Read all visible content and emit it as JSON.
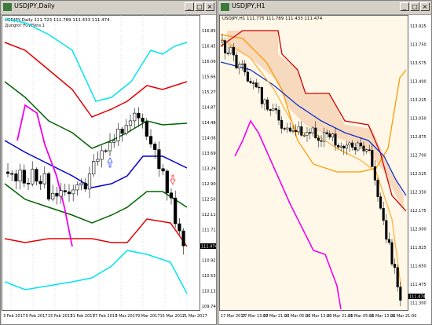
{
  "left_window": {
    "title": "USDJPY,Daily",
    "info_line": "USDJPY,Daily  111.723 111.789 111.433 111.474",
    "sub_info": "2Jungro? FOWStns 1",
    "price_labels": [
      "116.850",
      "116.455",
      "116.060",
      "115.665",
      "115.270",
      "114.875",
      "114.480",
      "114.085",
      "113.690",
      "113.295",
      "112.900",
      "112.505",
      "112.110",
      "111.715",
      "111.320",
      "110.925",
      "110.530",
      "110.135",
      "109.740"
    ],
    "date_labels": [
      "3 Feb 2017",
      "9 Feb 2017",
      "15 Feb 2017",
      "21 Feb 2017",
      "27 Feb 2017",
      "3 Mar 2017",
      "9 Mar 2017",
      "15 Mar 2017",
      "21 Mar 2017"
    ],
    "current_price": "111.474",
    "colors": {
      "bg": "#ffffff",
      "cyan": "#00e5ee",
      "red": "#e00000",
      "green": "#006400",
      "blue": "#0000cc",
      "magenta": "#ee00ee"
    }
  },
  "right_window": {
    "title": "USDJPY,H1",
    "info_line": "USDJPY,H1  111.775 111.789 111.433 111.474",
    "price_labels": [
      "113.925",
      "113.750",
      "113.575",
      "113.400",
      "113.225",
      "113.050",
      "112.875",
      "112.700",
      "112.525",
      "112.350",
      "112.175",
      "112.000",
      "111.825",
      "111.650",
      "111.475",
      "111.300"
    ],
    "date_labels": [
      "17 Mar 2017",
      "17 Mar 13:00",
      "17 Mar 21:00",
      "20 Mar 05:00",
      "20 Mar 13:00",
      "20 Mar 21:00",
      "21 Mar 05:00",
      "21 Mar 13:00",
      "21 Mar 21:00"
    ],
    "current_price": "111.474",
    "colors": {
      "bg": "#fff8e8",
      "orange": "#ff9900",
      "darkred": "#cc0000",
      "blue": "#1133cc",
      "magenta": "#ee00ee",
      "cloud": "#e8a070"
    }
  }
}
